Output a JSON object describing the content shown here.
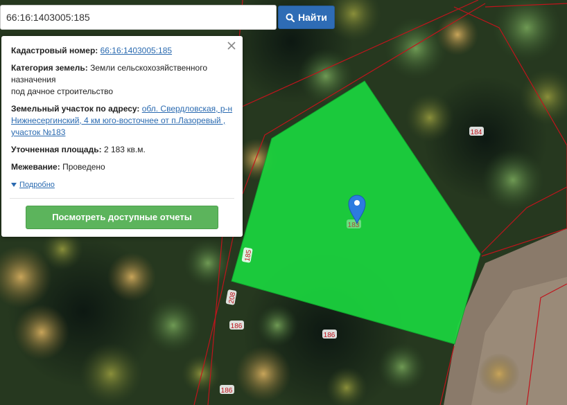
{
  "search": {
    "value": "66:16:1403005:185",
    "button_label": "Найти"
  },
  "info_panel": {
    "cadastral_label": "Кадастровый номер:",
    "cadastral_value": "66:16:1403005:185",
    "category_label": "Категория земель:",
    "category_value_line1": "Земли сельскохозяйственного назначения",
    "category_value_line2": "под дачное строительство",
    "address_label": "Земельный участок по адресу:",
    "address_value": "обл. Свердловская, р-н Нижнесергинский, 4 км юго-восточнее от п.Лазоревый , участок №183",
    "area_label": "Уточненная площадь:",
    "area_value": "2 183 кв.м.",
    "survey_label": "Межевание:",
    "survey_value": "Проведено",
    "details_link": "Подробно",
    "report_button": "Посмотреть доступные отчеты"
  },
  "map": {
    "parcel_labels": [
      "184",
      "185",
      "208",
      "186",
      "186",
      "186",
      "183"
    ],
    "selected_parcel_color": "#1bd43e",
    "boundary_color": "#c0141c"
  },
  "colors": {
    "accent_blue": "#2e6cb5",
    "button_green": "#5cb45c",
    "link_blue": "#2a6ab0"
  }
}
